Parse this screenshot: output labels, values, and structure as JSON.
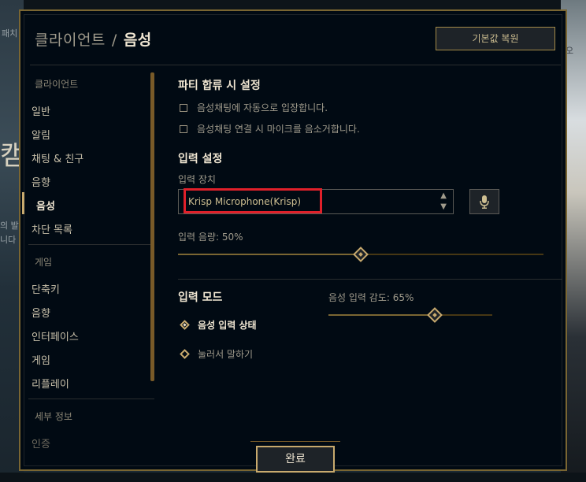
{
  "background": {
    "left_text_1": "패치",
    "left_text_2": "캠",
    "left_text_3": "의 발",
    "left_text_4": "니다",
    "right_text": "오"
  },
  "header": {
    "breadcrumb_root": "클라이언트",
    "separator": "/",
    "current": "음성",
    "reset_label": "기본값 복원"
  },
  "sidebar": {
    "client_heading": "클라이언트",
    "client_items": [
      "일반",
      "알림",
      "채팅 & 친구",
      "음향",
      "음성",
      "차단 목록"
    ],
    "active_item": "음성",
    "game_heading": "게임",
    "game_items": [
      "단축키",
      "음향",
      "인터페이스",
      "게임",
      "리플레이"
    ],
    "info_heading": "세부 정보",
    "info_items": [
      "인증"
    ]
  },
  "party": {
    "title": "파티 합류 시 설정",
    "option_auto_join": "음성채팅에 자동으로 입장합니다.",
    "option_mute_mic": "음성채팅 연결 시 마이크를 음소거합니다."
  },
  "input_settings": {
    "title": "입력 설정",
    "device_label": "입력 장치",
    "device_value": "Krisp Microphone(Krisp)",
    "volume_label": "입력 음량: 50%",
    "volume_value": 0.5
  },
  "input_mode": {
    "title": "입력 모드",
    "sensitivity_label": "음성 입력 감도: 65%",
    "sensitivity_value": 0.65,
    "option_voice_activation": "음성 입력 상태",
    "option_push_to_talk": "눌러서 말하기",
    "selected": "음성 입력 상태"
  },
  "footer": {
    "done_label": "완료"
  },
  "colors": {
    "gold": "#c8aa6e",
    "highlight": "#e0202a",
    "modal_bg": "#010a13"
  }
}
